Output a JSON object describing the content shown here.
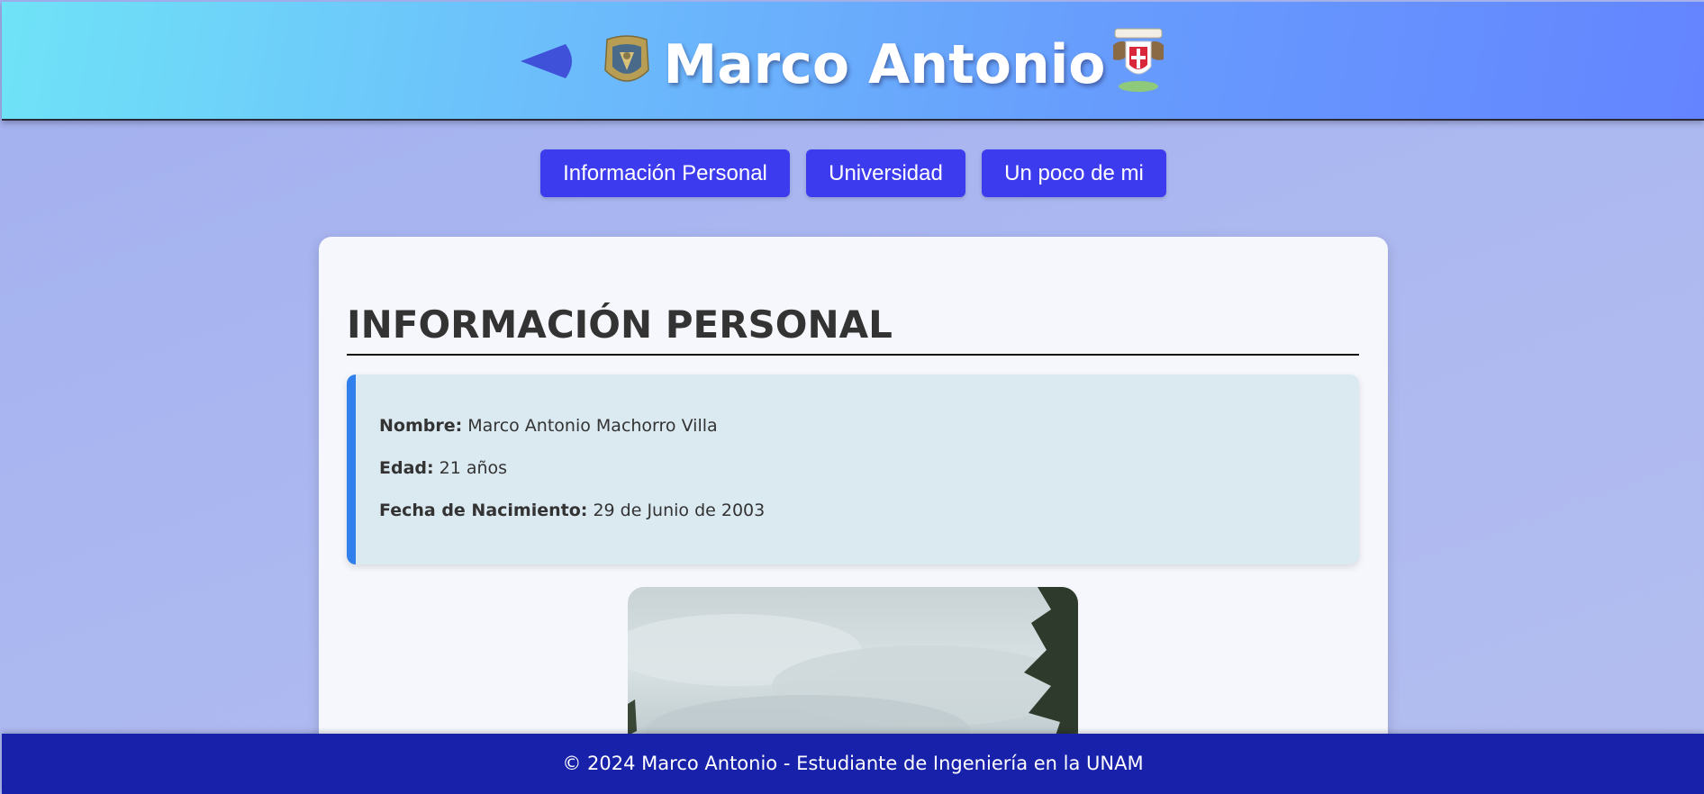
{
  "header": {
    "title": "Marco Antonio",
    "back_icon": "back-arrow-icon",
    "left_logo": "unam-logo",
    "right_logo": "ingenieria-logo"
  },
  "nav": {
    "items": [
      {
        "label": "Información Personal"
      },
      {
        "label": "Universidad"
      },
      {
        "label": "Un poco de mi"
      }
    ]
  },
  "section": {
    "title": "INFORMACIÓN PERSONAL",
    "fields": [
      {
        "label": "Nombre:",
        "value": "Marco Antonio Machorro Villa"
      },
      {
        "label": "Edad:",
        "value": "21 años"
      },
      {
        "label": "Fecha de Nacimiento:",
        "value": "29 de Junio de 2003"
      }
    ]
  },
  "footer": {
    "text": "© 2024 Marco Antonio - Estudiante de Ingeniería en la UNAM"
  },
  "colors": {
    "nav_button": "#3d3bee",
    "footer_bg": "#1721a9",
    "info_accent": "#2f80ed",
    "back_icon": "#3f51d8"
  }
}
